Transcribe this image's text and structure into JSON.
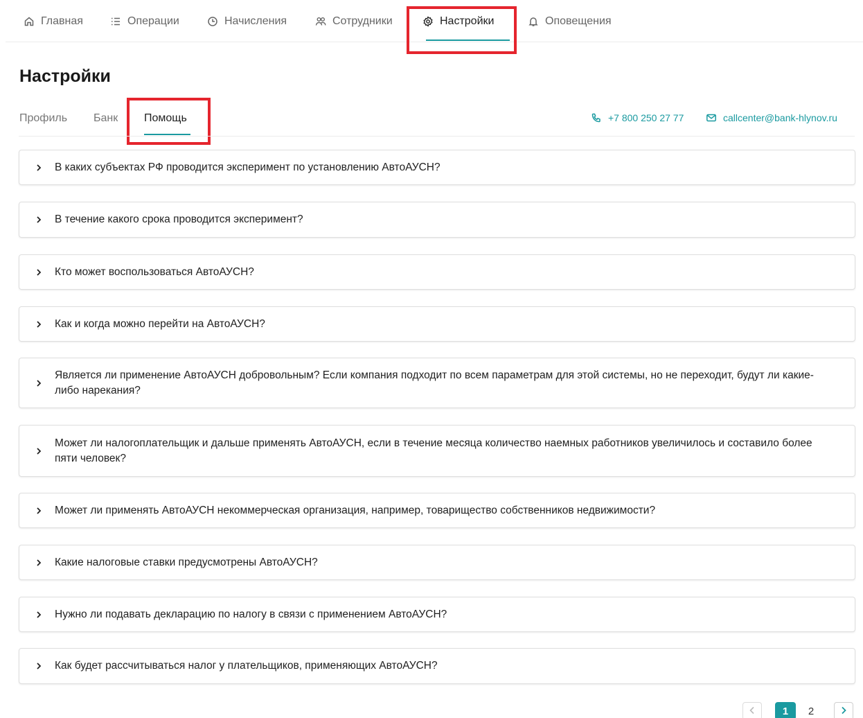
{
  "nav": {
    "items": [
      {
        "label": "Главная",
        "icon": "home-icon"
      },
      {
        "label": "Операции",
        "icon": "list-icon"
      },
      {
        "label": "Начисления",
        "icon": "clock-icon"
      },
      {
        "label": "Сотрудники",
        "icon": "users-icon"
      },
      {
        "label": "Настройки",
        "icon": "gear-icon"
      },
      {
        "label": "Оповещения",
        "icon": "bell-icon"
      }
    ],
    "active_index": 4
  },
  "page": {
    "title": "Настройки"
  },
  "subtabs": {
    "items": [
      {
        "label": "Профиль"
      },
      {
        "label": "Банк"
      },
      {
        "label": "Помощь"
      }
    ],
    "active_index": 2
  },
  "contacts": {
    "phone": "+7 800 250 27 77",
    "email": "callcenter@bank-hlynov.ru"
  },
  "faq": [
    "В каких субъектах РФ проводится эксперимент по установлению АвтоАУСН?",
    "В течение какого срока проводится эксперимент?",
    "Кто может воспользоваться АвтоАУСН?",
    "Как и когда можно перейти на АвтоАУСН?",
    "Является ли применение АвтоАУСН добровольным? Если компания подходит по всем параметрам для этой системы, но не переходит, будут ли какие-либо нарекания?",
    "Может ли налогоплательщик и дальше применять АвтоАУСН, если в течение месяца количество наемных работников увеличилось и составило более пяти человек?",
    "Может ли применять АвтоАУСН некоммерческая организация, например, товарищество собственников недвижимости?",
    "Какие налоговые ставки предусмотрены АвтоАУСН?",
    "Нужно ли подавать декларацию по налогу в связи с применением АвтоАУСН?",
    "Как будет рассчитываться налог у плательщиков, применяющих АвтоАУСН?"
  ],
  "pagination": {
    "pages": [
      "1",
      "2"
    ],
    "current": "1",
    "prev_icon": "chevron-left-icon",
    "next_icon": "chevron-right-icon"
  },
  "colors": {
    "accent": "#1a9aa0",
    "highlight": "#e5252e"
  }
}
